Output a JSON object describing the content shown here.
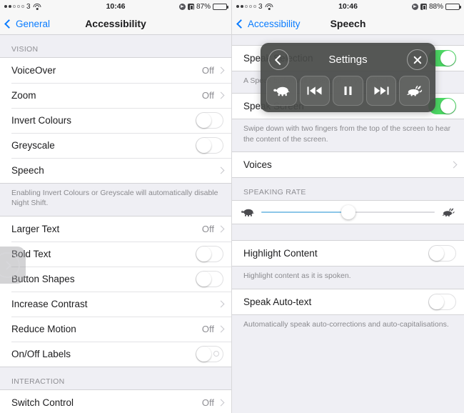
{
  "left": {
    "status": {
      "carrier": "3",
      "time": "10:46",
      "battery": "87%",
      "icons": {
        "wifi": "wifi-icon",
        "location": "location-arrow-icon",
        "lock": "rotation-lock-icon",
        "battery": "battery-icon"
      }
    },
    "nav": {
      "back": "General",
      "title": "Accessibility"
    },
    "sections": [
      {
        "header": "VISION",
        "rows": [
          {
            "label": "VoiceOver",
            "value": "Off",
            "type": "disclosure"
          },
          {
            "label": "Zoom",
            "value": "Off",
            "type": "disclosure"
          },
          {
            "label": "Invert Colours",
            "type": "toggle",
            "on": false
          },
          {
            "label": "Greyscale",
            "type": "toggle",
            "on": false
          },
          {
            "label": "Speech",
            "value": "",
            "type": "disclosure"
          }
        ],
        "footnote": "Enabling Invert Colours or Greyscale will automatically disable Night Shift."
      },
      {
        "header": "",
        "rows": [
          {
            "label": "Larger Text",
            "value": "Off",
            "type": "disclosure"
          },
          {
            "label": "Bold Text",
            "type": "toggle",
            "on": false
          },
          {
            "label": "Button Shapes",
            "type": "toggle",
            "on": false
          },
          {
            "label": "Increase Contrast",
            "value": "",
            "type": "disclosure"
          },
          {
            "label": "Reduce Motion",
            "value": "Off",
            "type": "disclosure"
          },
          {
            "label": "On/Off Labels",
            "type": "toggle",
            "on": false,
            "offmark": true
          }
        ],
        "footnote": ""
      },
      {
        "header": "INTERACTION",
        "rows": [
          {
            "label": "Switch Control",
            "value": "Off",
            "type": "disclosure"
          }
        ],
        "footnote": ""
      }
    ],
    "assistive_touch": {
      "name": "assistive-touch-button"
    }
  },
  "right": {
    "status": {
      "carrier": "3",
      "time": "10:46",
      "battery": "88%"
    },
    "nav": {
      "back": "Accessibility",
      "title": "Speech"
    },
    "rows": [
      {
        "label": "Speak Selection",
        "type": "toggle",
        "on": true
      },
      {
        "label": "Speak Screen",
        "type": "toggle",
        "on": true
      },
      {
        "label": "Voices",
        "value": "",
        "type": "disclosure"
      },
      {
        "label": "Highlight Content",
        "type": "toggle",
        "on": false
      },
      {
        "label": "Speak Auto-text",
        "type": "toggle",
        "on": false
      }
    ],
    "footnotes": {
      "speak_selection": "A Speak button will appear when you select text.",
      "speak_screen": "Swipe down with two fingers from the top of the screen to hear the content of the screen.",
      "highlight_content": "Highlight content as it is spoken.",
      "speak_auto_text": "Automatically speak auto-corrections and auto-capitalisations."
    },
    "speaking_rate": {
      "header": "SPEAKING RATE",
      "value": 50,
      "min_icon": "turtle-icon",
      "max_icon": "rabbit-icon"
    },
    "controller": {
      "title": "Settings",
      "back_icon": "chevron-left-icon",
      "close_icon": "close-x-icon",
      "buttons": [
        {
          "name": "slow-rate-button",
          "icon": "turtle-icon"
        },
        {
          "name": "rewind-button",
          "icon": "rewind-icon"
        },
        {
          "name": "pause-button",
          "icon": "pause-icon"
        },
        {
          "name": "fast-forward-button",
          "icon": "fast-forward-icon"
        },
        {
          "name": "fast-rate-button",
          "icon": "rabbit-icon"
        }
      ]
    }
  },
  "colors": {
    "accent": "#0a7cff",
    "toggle_on": "#4cd864",
    "slider_fill": "#8cc6e8",
    "bg": "#efeff4"
  }
}
